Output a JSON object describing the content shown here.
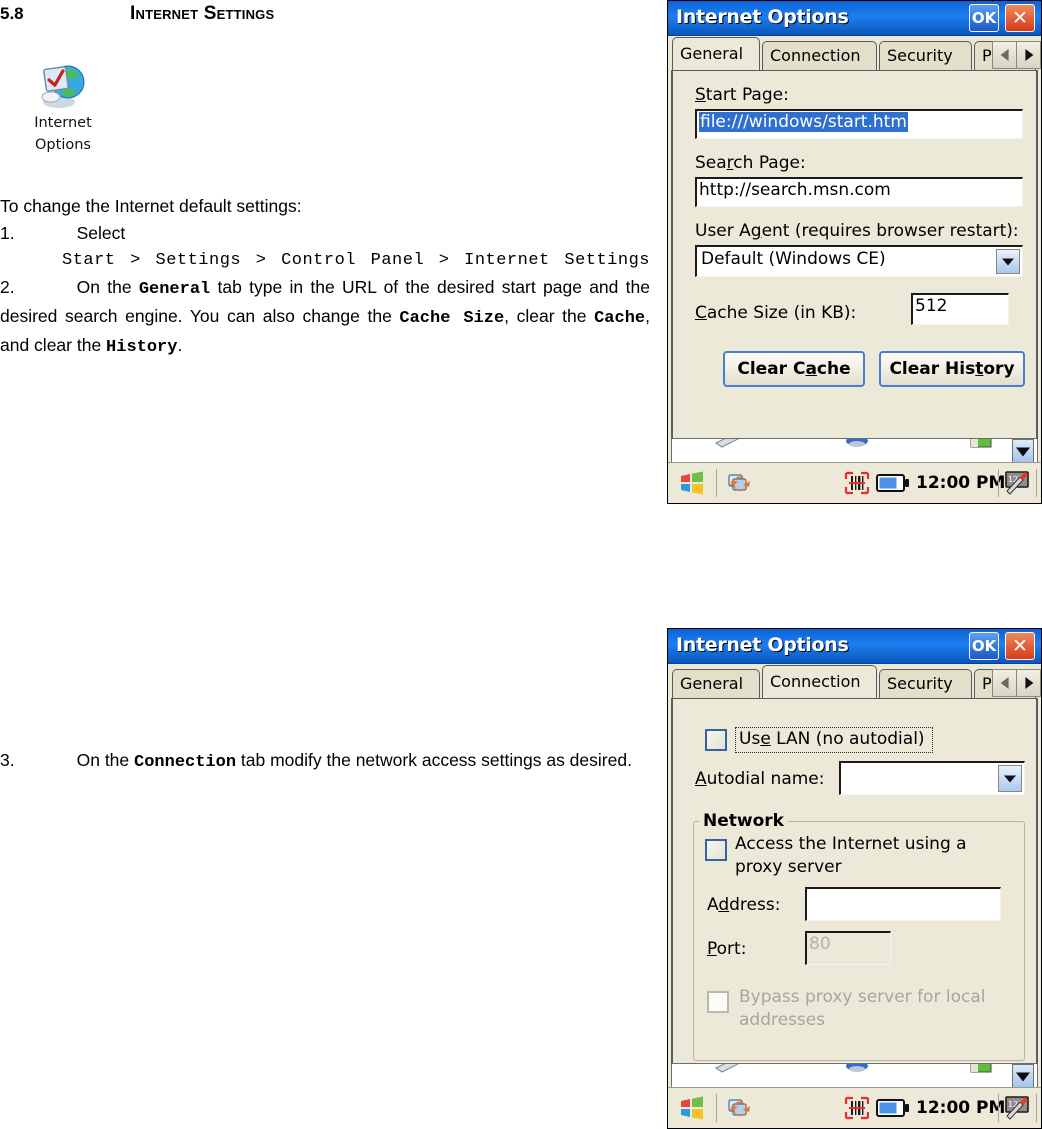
{
  "document": {
    "section_number": "5.8",
    "section_title": "Internet Settings",
    "desktop_icon": {
      "name": "internet-options-icon",
      "caption_line1": "Internet",
      "caption_line2": "Options"
    },
    "intro": "To change the Internet default settings:",
    "step1_num": "1.",
    "step1_text": "Select",
    "step1_path": "Start > Settings > Control Panel > Internet Settings",
    "step2_num": "2.",
    "step2_a": "On the ",
    "step2_b": "General",
    "step2_c": " tab type in the URL of the desired start page and the desired search engine. You can also change the ",
    "step2_d": "Cache Size",
    "step2_e": ", clear the ",
    "step2_f": "Cache",
    "step2_g": ", and clear the ",
    "step2_h": "History",
    "step2_i": ".",
    "step3_num": "3.",
    "step3_a": "On the ",
    "step3_b": "Connection",
    "step3_c": " tab modify the network access settings as desired."
  },
  "dialog_general": {
    "title": "Internet Options",
    "ok_label": "OK",
    "close_label": "✕",
    "tabs": [
      {
        "label": "General",
        "active": true
      },
      {
        "label": "Connection",
        "active": false
      },
      {
        "label": "Security",
        "active": false
      },
      {
        "label": "Pri",
        "active": false
      }
    ],
    "tab_prev_icon": "triangle-left-icon",
    "tab_next_icon": "triangle-right-icon",
    "start_page_label": "Start Page:",
    "start_page_value": "file:///windows/start.htm",
    "search_page_label": "Search Page:",
    "search_page_value": "http://search.msn.com",
    "user_agent_label": "User Agent (requires browser restart):",
    "user_agent_value": "Default (Windows CE)",
    "cache_size_label": "Cache Size (in KB):",
    "cache_size_value": "512",
    "clear_cache_label": "Clear Cache",
    "clear_history_label": "Clear History"
  },
  "dialog_connection": {
    "title": "Internet Options",
    "ok_label": "OK",
    "close_label": "✕",
    "tabs": [
      {
        "label": "General",
        "active": false
      },
      {
        "label": "Connection",
        "active": true
      },
      {
        "label": "Security",
        "active": false
      },
      {
        "label": "Pri",
        "active": false
      }
    ],
    "tab_prev_icon": "triangle-left-icon",
    "tab_next_icon": "triangle-right-icon",
    "use_lan_label": "Use LAN (no autodial)",
    "use_lan_checked": false,
    "autodial_label": "Autodial name:",
    "autodial_value": "",
    "network_group_label": "Network",
    "proxy_label_line1": "Access the Internet using a",
    "proxy_label_line2": "proxy server",
    "proxy_checked": false,
    "address_label": "Address:",
    "address_value": "",
    "port_label": "Port:",
    "port_value": "80",
    "port_disabled": true,
    "bypass_label_line1": "Bypass proxy server for local",
    "bypass_label_line2": "addresses",
    "bypass_checked": false,
    "bypass_disabled": true
  },
  "taskbar": {
    "start_icon": "windows-start-icon",
    "sync_icon": "activesync-icon",
    "barcode_icon": "barcode-scanner-icon",
    "battery_icon": "battery-icon",
    "clock": "12:00 PM",
    "sip_icon": "input-panel-keyboard-icon",
    "updown_icon": "sip-selector-arrow-icon"
  },
  "colors": {
    "titlebar_blue": "#1d7ef0",
    "dialog_face": "#ece9d8",
    "selection_blue": "#2f6fd0",
    "close_red": "#d43b18",
    "button_border_blue": "#4a7fd0",
    "disabled_gray": "#b3b3a8"
  }
}
